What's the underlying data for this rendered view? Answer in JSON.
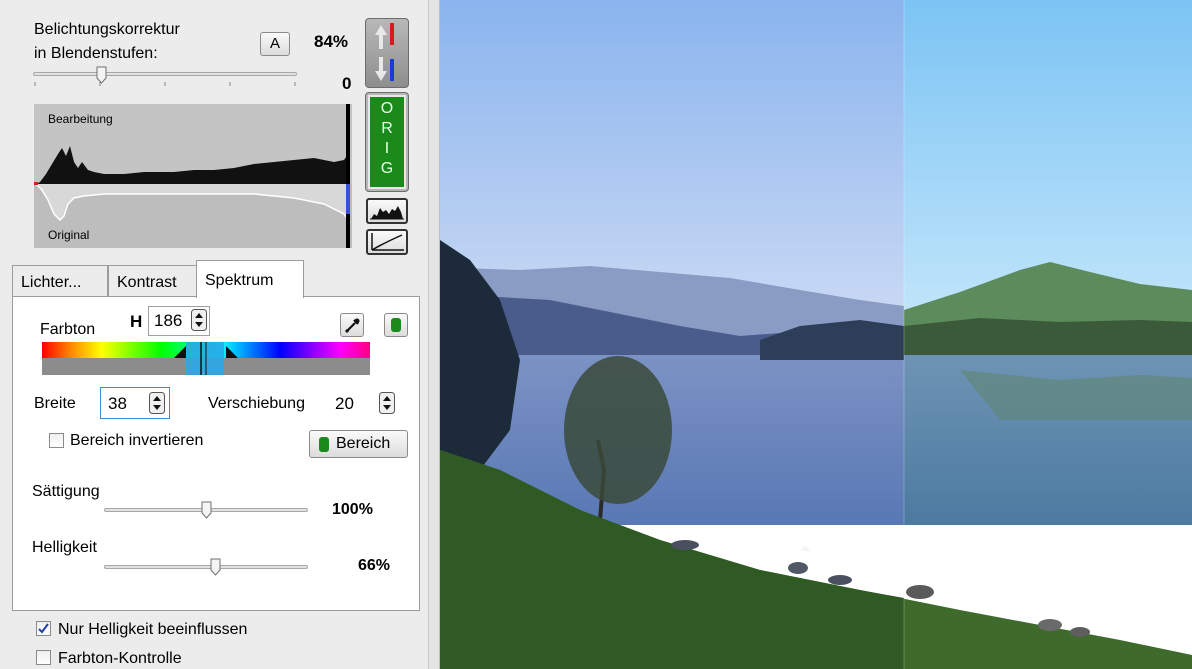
{
  "exposure": {
    "label_line1": "Belichtungskorrektur",
    "label_line2": "in Blendenstufen:",
    "auto_button": "A",
    "percent": "84%",
    "value": "0",
    "slider_level_fraction": 0.25
  },
  "histogram": {
    "label_top": "Bearbeitung",
    "label_bottom": "Original"
  },
  "orig_button": {
    "letters": [
      "O",
      "R",
      "I",
      "G"
    ],
    "color": "#1a8a1a"
  },
  "tabs": [
    {
      "label": "Lichter..."
    },
    {
      "label": "Kontrast"
    },
    {
      "label": "Spektrum",
      "active": true
    }
  ],
  "spectrum": {
    "hue_label": "Farbton",
    "h_label": "H",
    "h_value": "186",
    "width_label": "Breite",
    "width_value": "38",
    "shift_label": "Verschiebung",
    "shift_value": "20",
    "invert_label": "Bereich invertieren",
    "invert_checked": false,
    "range_button": "Bereich",
    "saturation_label": "Sättigung",
    "saturation_value": "100%",
    "saturation_level": 0.5,
    "brightness_label": "Helligkeit",
    "brightness_value": "66%",
    "brightness_level": 0.55
  },
  "options": {
    "only_brightness_label": "Nur Helligkeit beeinflussen",
    "only_brightness_checked": true,
    "hue_control_label": "Farbton-Kontrolle",
    "hue_control_checked": false
  },
  "colors": {
    "accent_green": "#1a8a1a",
    "selection_blue": "#29a8e8"
  },
  "icons": {
    "arrow_up_down": "up-down-arrows-icon",
    "histogram": "histogram-icon",
    "curve": "curve-icon",
    "eyedropper": "eyedropper-icon",
    "green_indicator": "green-indicator-icon"
  }
}
